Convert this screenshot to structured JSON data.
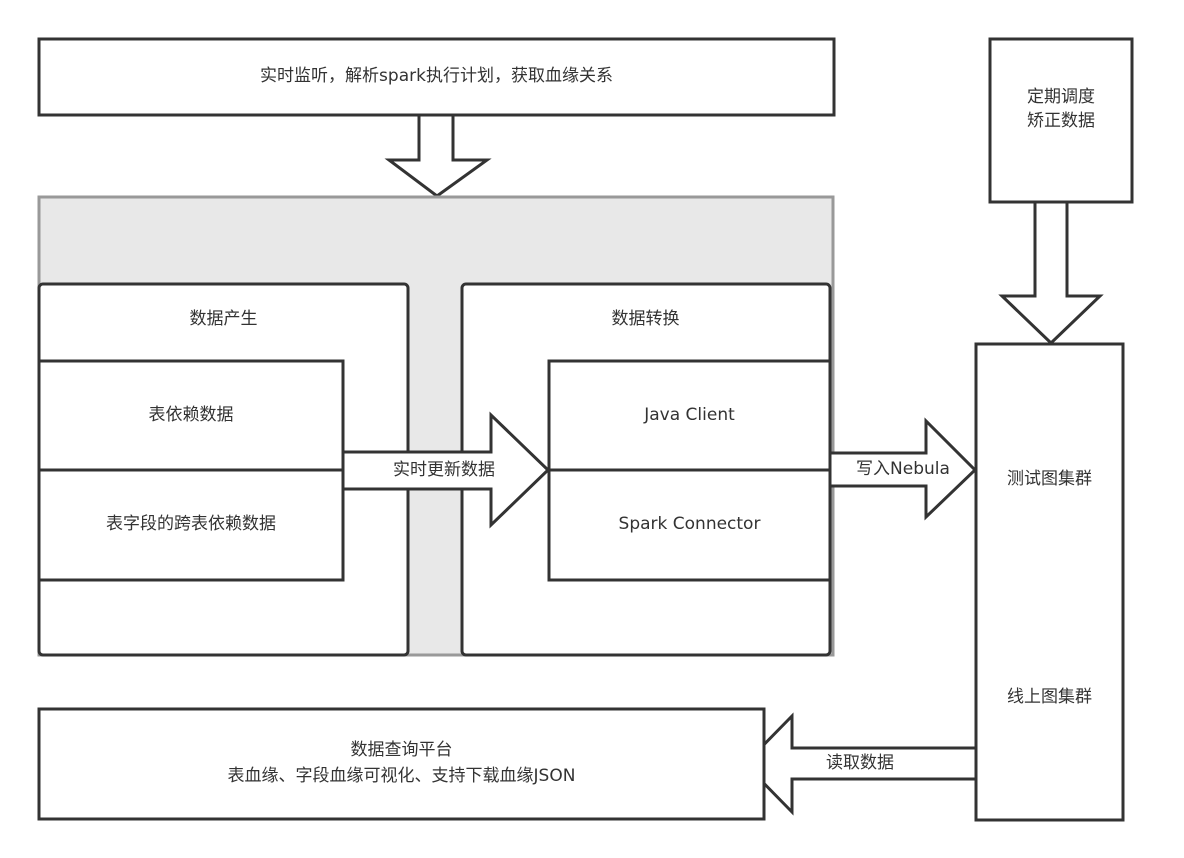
{
  "diagram": {
    "top_box": {
      "label": "实时监听，解析spark执行计划，获取血缘关系"
    },
    "data_generation": {
      "title": "数据产生",
      "rows": [
        "表依赖数据",
        "表字段的跨表依赖数据"
      ]
    },
    "data_conversion": {
      "title": "数据转换",
      "rows": [
        "Java Client",
        "Spark Connector"
      ]
    },
    "arrow_realtime_update": {
      "label": "实时更新数据"
    },
    "arrow_write_nebula": {
      "label": "写入Nebula"
    },
    "scheduler_box": {
      "label": "定期调度\n矫正数据"
    },
    "cluster_box": {
      "items": [
        "测试图集群",
        "线上图集群"
      ]
    },
    "arrow_read_data": {
      "label": "读取数据"
    },
    "query_platform": {
      "title": "数据查询平台",
      "subtitle": "表血缘、字段血缘可视化、支持下载血缘JSON"
    },
    "colors": {
      "stroke": "#333333",
      "container_fill": "#e8e8e8",
      "container_stroke": "#999999",
      "box_fill": "#ffffff",
      "text": "#333333"
    }
  }
}
